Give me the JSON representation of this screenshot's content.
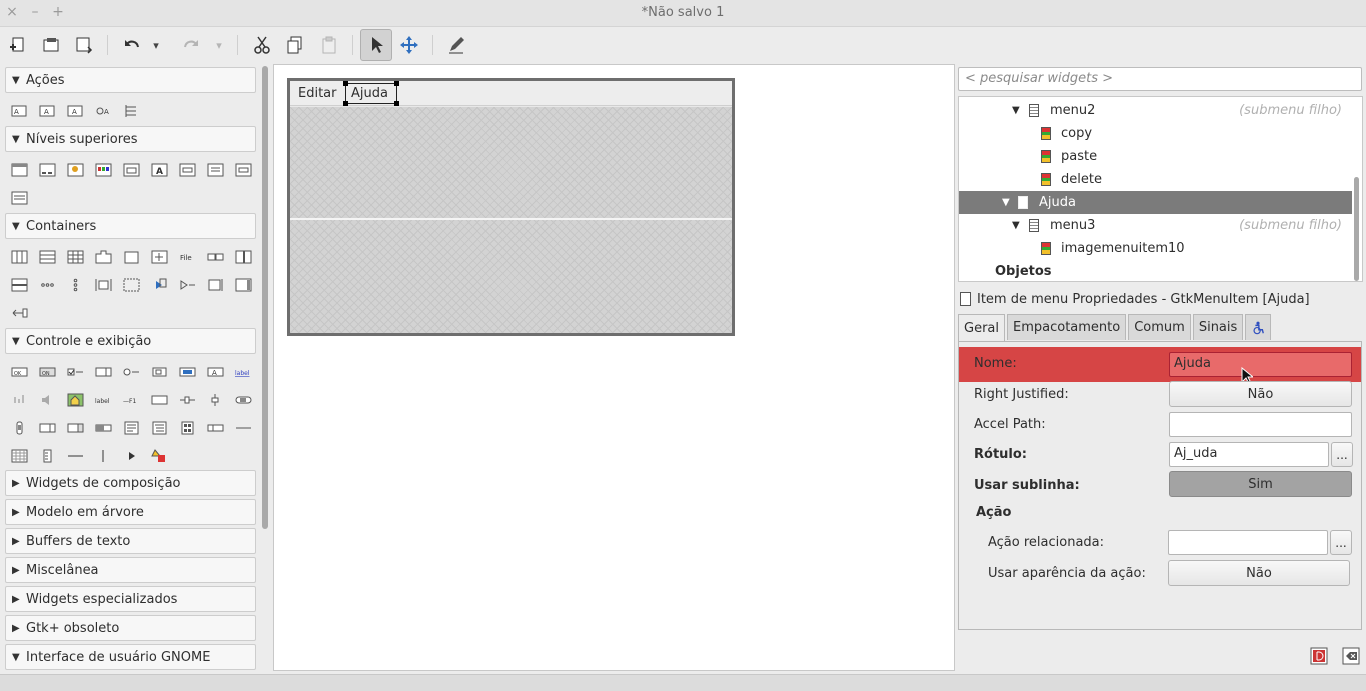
{
  "window": {
    "title": "*Não salvo 1",
    "close": "×",
    "minimize": "–",
    "maximize": "+"
  },
  "toolbar": {
    "redo_dropdown": "▾",
    "undo_dropdown": "▾"
  },
  "palette": {
    "sections": [
      {
        "label": "Ações",
        "expanded": true
      },
      {
        "label": "Níveis superiores",
        "expanded": true
      },
      {
        "label": "Containers",
        "expanded": true
      },
      {
        "label": "Controle e exibição",
        "expanded": true
      },
      {
        "label": "Widgets de composição",
        "expanded": false
      },
      {
        "label": "Modelo em árvore",
        "expanded": false
      },
      {
        "label": "Buffers de texto",
        "expanded": false
      },
      {
        "label": "Miscelânea",
        "expanded": false
      },
      {
        "label": "Widgets especializados",
        "expanded": false
      },
      {
        "label": "Gtk+ obsoleto",
        "expanded": false
      },
      {
        "label": "Interface de usuário GNOME",
        "expanded": true
      }
    ]
  },
  "design": {
    "menu_editar": "Editar",
    "menu_ajuda": "Ajuda"
  },
  "inspector": {
    "search_placeholder": "< pesquisar widgets >",
    "tree": [
      {
        "label": "menu2",
        "hint": "(submenu filho)"
      },
      {
        "label": "copy",
        "hint": ""
      },
      {
        "label": "paste",
        "hint": ""
      },
      {
        "label": "delete",
        "hint": ""
      },
      {
        "label": "Ajuda",
        "hint": ""
      },
      {
        "label": "menu3",
        "hint": "(submenu filho)"
      },
      {
        "label": "imagemenuitem10",
        "hint": ""
      },
      {
        "label": "Objetos",
        "hint": ""
      }
    ]
  },
  "properties": {
    "header": "Item de menu Propriedades - GtkMenuItem [Ajuda]",
    "tabs": [
      "Geral",
      "Empacotamento",
      "Comum",
      "Sinais"
    ],
    "nome_label": "Nome:",
    "nome_value": "Ajuda",
    "right_justified_label": "Right Justified:",
    "right_justified_value": "Não",
    "accel_path_label": "Accel Path:",
    "accel_path_value": "",
    "rotulo_label": "Rótulo:",
    "rotulo_value": "Aj_uda",
    "usar_sublinha_label": "Usar sublinha:",
    "usar_sublinha_value": "Sim",
    "acao_group": "Ação",
    "acao_relacionada_label": "Ação relacionada:",
    "acao_relacionada_value": "",
    "usar_aparencia_label": "Usar aparência da ação:",
    "usar_aparencia_value": "Não",
    "ellipsis": "..."
  },
  "colors": {
    "highlight_red": "#d64545",
    "selection_gray": "#7b7b7b"
  }
}
